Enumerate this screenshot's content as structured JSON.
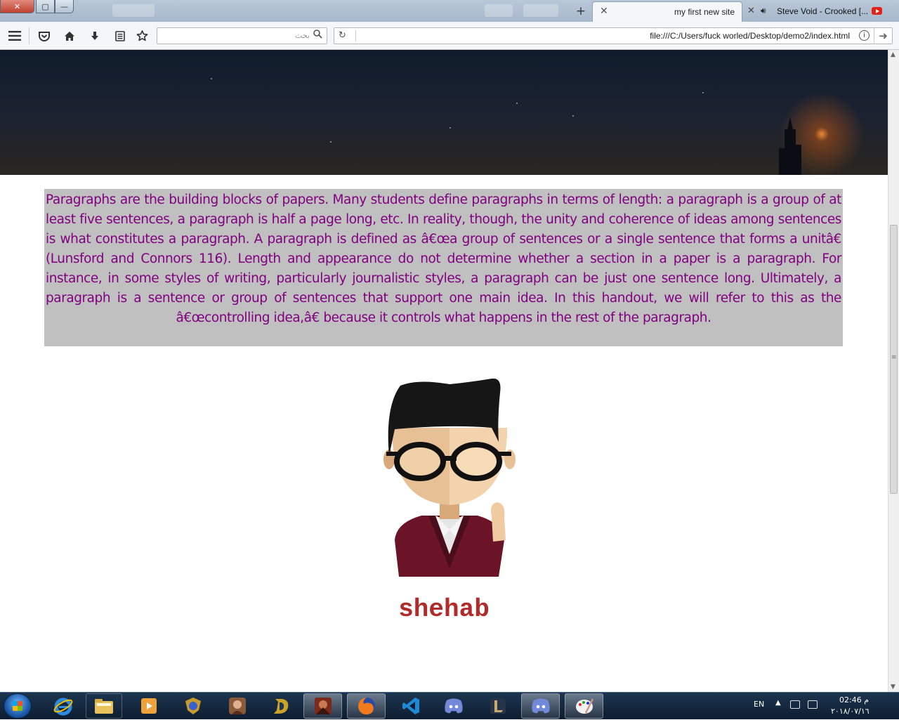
{
  "browser": {
    "tabs": [
      {
        "title": "my first new site",
        "active": true
      },
      {
        "title": "Steve Void - Crooked [...",
        "active": false,
        "playing_audio": true
      }
    ],
    "search": {
      "placeholder": "بحث"
    },
    "url": "file:///C:/Users/fuck worled/Desktop/demo2/index.html",
    "window_controls": {
      "close": "✕",
      "restore": "▢",
      "minimize": "—"
    },
    "toolbar_icons": [
      "menu-icon",
      "pocket-icon",
      "home-icon",
      "download-icon",
      "reader-list-icon",
      "bookmark-star-icon"
    ]
  },
  "page": {
    "paragraph": "Paragraphs are the building blocks of papers. Many students define paragraphs in terms of length: a paragraph is a group of at least five sentences, a paragraph is half a page long, etc. In reality, though, the unity and coherence of ideas among sentences is what constitutes a paragraph. A paragraph is defined as â€œa group of sentences or a single sentence that forms a unitâ€ (Lunsford and Connors 116). Length and appearance do not determine whether a section in a paper is a paragraph. For instance, in some styles of writing, particularly journalistic styles, a paragraph can be just one sentence long. Ultimately, a paragraph is a sentence or group of sentences that support one main idea. In this handout, we will refer to this as the â€œcontrolling idea,â€ because it controls what happens in the rest of the paragraph.",
    "name": "shehab",
    "colors": {
      "paragraph_text": "#800080",
      "paragraph_bg": "#c0c0c0",
      "name_text": "#b22b2b"
    }
  },
  "taskbar": {
    "apps": [
      "internet-explorer-icon",
      "file-explorer-icon",
      "media-player-icon",
      "game-shield-icon",
      "game-hero-icon",
      "gold-d-icon",
      "warrior-game-icon",
      "firefox-icon",
      "vscode-icon",
      "discord-icon",
      "league-icon",
      "discord-icon",
      "paint-icon"
    ],
    "active_app": "firefox-icon",
    "language": "EN",
    "time": "02:46 م",
    "date": "٢٠١٨/٠٧/١٦"
  }
}
